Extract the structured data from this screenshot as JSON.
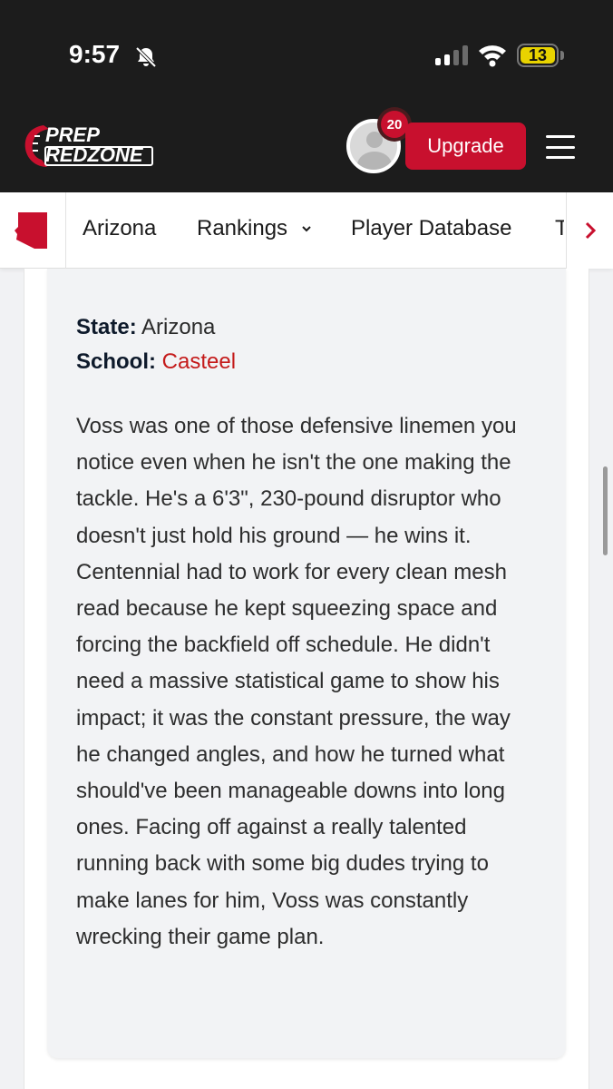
{
  "status_bar": {
    "time": "9:57",
    "battery": "13",
    "icons": [
      "bell-slash-icon",
      "signal-icon",
      "wifi-icon",
      "battery-icon"
    ]
  },
  "header": {
    "logo_line1": "PREP",
    "logo_line2": "REDZONE",
    "notification_count": "20",
    "upgrade_label": "Upgrade",
    "brand_color": "#c8102e",
    "header_bg": "#1c1c1c"
  },
  "subnav": {
    "state_icon": "arizona-state-icon",
    "items": [
      {
        "label": "Arizona"
      },
      {
        "label": "Rankings"
      },
      {
        "label": "Player Database"
      },
      {
        "label": "T"
      }
    ],
    "scroll_icon": "chevron-right-icon"
  },
  "profile": {
    "state_label": "State:",
    "state_value": "Arizona",
    "school_label": "School:",
    "school_value": "Casteel"
  },
  "article": {
    "text": "Voss was one of those defensive linemen you notice even when he isn't the one making the tackle. He's a 6'3\", 230-pound disruptor who doesn't just hold his ground — he wins it. Centennial had to work for every clean mesh read because he kept squeezing space and forcing the backfield off schedule. He didn't need a massive statistical game to show his impact; it was the constant pressure, the way he changed angles, and how he turned what should've been manageable downs into long ones. Facing off against a really talented running back with some big dudes trying to make lanes for him, Voss was constantly wrecking their game plan."
  }
}
